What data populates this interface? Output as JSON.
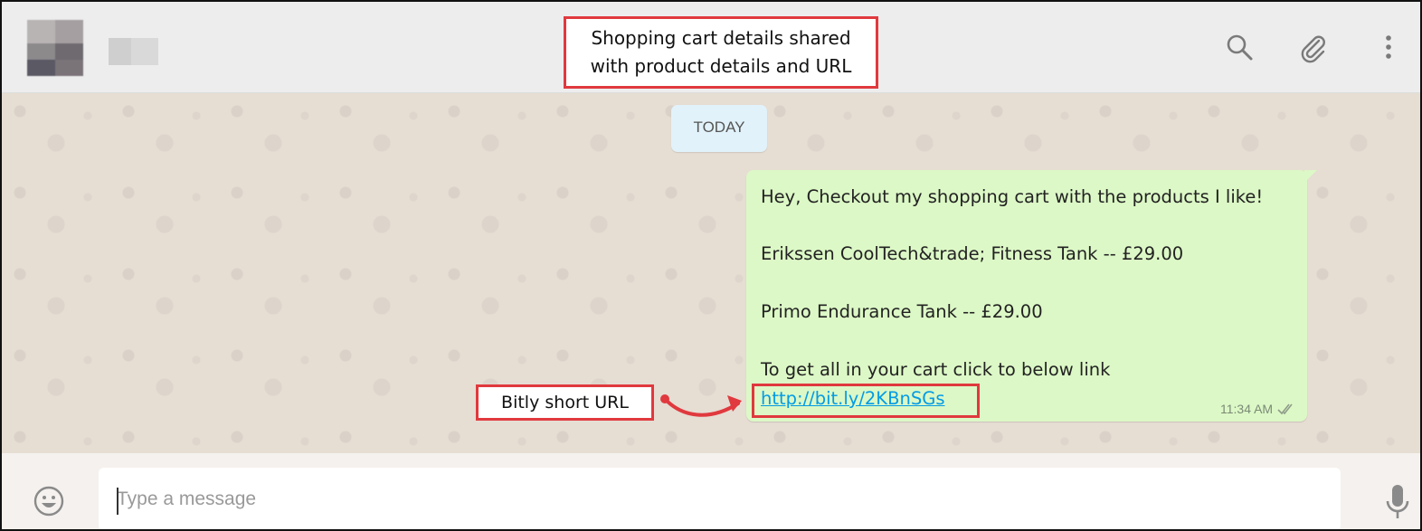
{
  "header": {
    "callout_line1": "Shopping cart details shared",
    "callout_line2": "with product details and URL"
  },
  "chat": {
    "date_chip": "TODAY",
    "message": {
      "line1": "Hey, Checkout my shopping cart with the products I like!",
      "line2": "Erikssen CoolTech&trade; Fitness Tank -- £29.00",
      "line3": "Primo Endurance Tank -- £29.00",
      "line4": "To get all in your cart click to below link",
      "link": "http://bit.ly/2KBnSGs",
      "time": "11:34 AM"
    },
    "callout_left": "Bitly short URL"
  },
  "footer": {
    "placeholder": "Type a message"
  },
  "colors": {
    "annotation_red": "#e0393e",
    "bubble_green": "#dcf8c6",
    "link_blue": "#039be5"
  },
  "icons": [
    "search-icon",
    "paperclip-icon",
    "menu-dots-icon",
    "emoji-icon",
    "microphone-icon",
    "double-check-icon"
  ]
}
